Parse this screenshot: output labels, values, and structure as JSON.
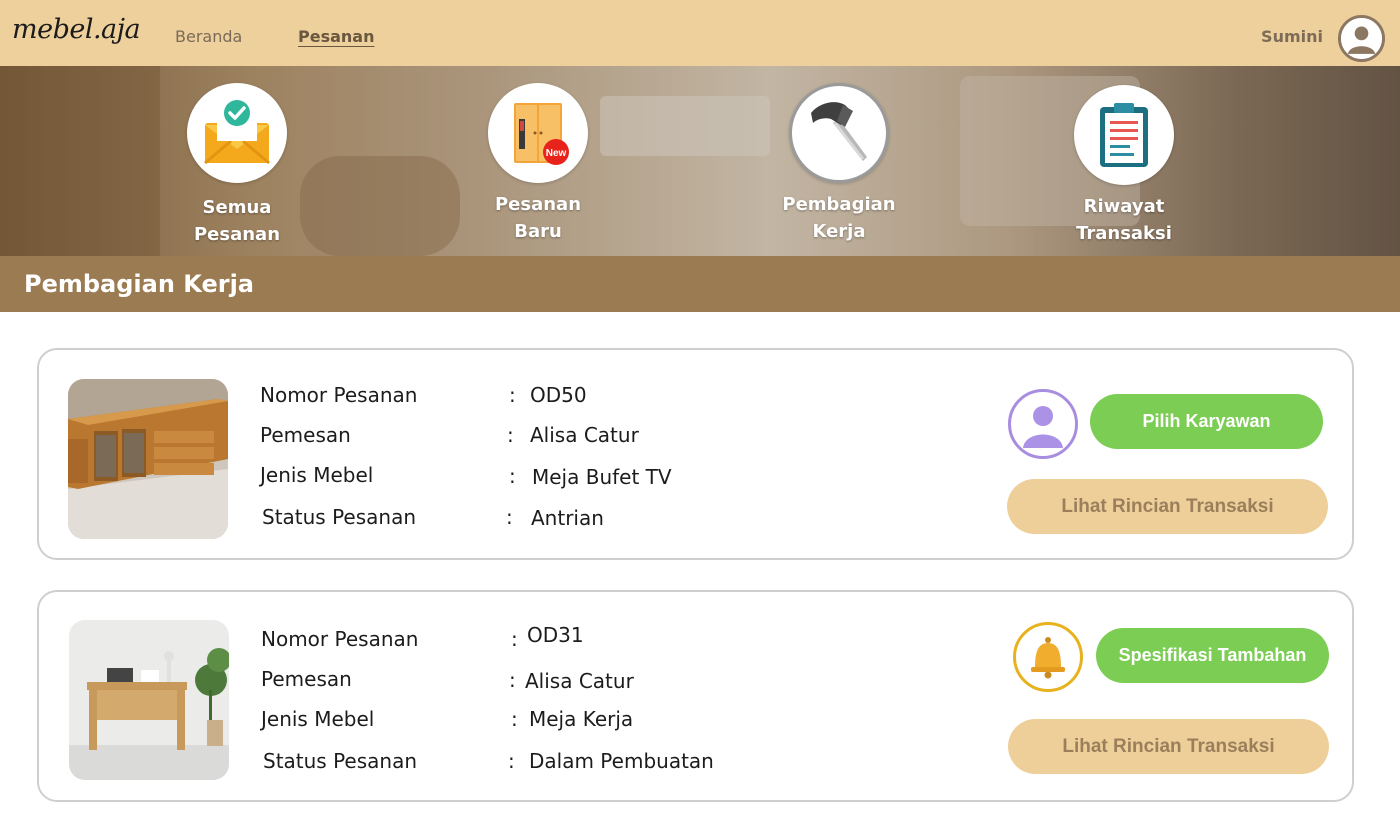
{
  "header": {
    "logo": "mebel.aja",
    "nav": [
      {
        "label": "Beranda",
        "active": false
      },
      {
        "label": "Pesanan",
        "active": true
      }
    ],
    "user_name": "Sumini",
    "bg_color": "#eed09c"
  },
  "quick_menu": [
    {
      "label_line1": "Semua",
      "label_line2": "Pesanan",
      "icon": "envelope-check-icon"
    },
    {
      "label_line1": "Pesanan",
      "label_line2": "Baru",
      "icon": "wardrobe-new-icon",
      "badge": "New"
    },
    {
      "label_line1": "Pembagian",
      "label_line2": "Kerja",
      "icon": "hammer-icon",
      "selected": true
    },
    {
      "label_line1": "Riwayat",
      "label_line2": "Transaksi",
      "icon": "clipboard-icon"
    }
  ],
  "section_title": "Pembagian Kerja",
  "field_labels": {
    "order_number": "Nomor Pesanan",
    "customer": "Pemesan",
    "furniture_type": "Jenis Mebel",
    "status": "Status Pesanan",
    "colon": ":"
  },
  "orders": [
    {
      "order_number": "OD50",
      "customer": "Alisa Catur",
      "furniture_type": "Meja Bufet TV",
      "status": "Antrian",
      "action_icon": "user-avatar-icon",
      "primary_button": "Pilih Karyawan",
      "secondary_button": "Lihat Rincian Transaksi"
    },
    {
      "order_number": "OD31",
      "customer": "Alisa Catur",
      "furniture_type": "Meja Kerja",
      "status": "Dalam Pembuatan",
      "action_icon": "bell-icon",
      "primary_button": "Spesifikasi Tambahan",
      "secondary_button": "Lihat Rincian Transaksi"
    }
  ],
  "colors": {
    "accent_green": "#7ccd53",
    "tan_button": "#eecf9a",
    "section_bar": "#9b7b52"
  }
}
